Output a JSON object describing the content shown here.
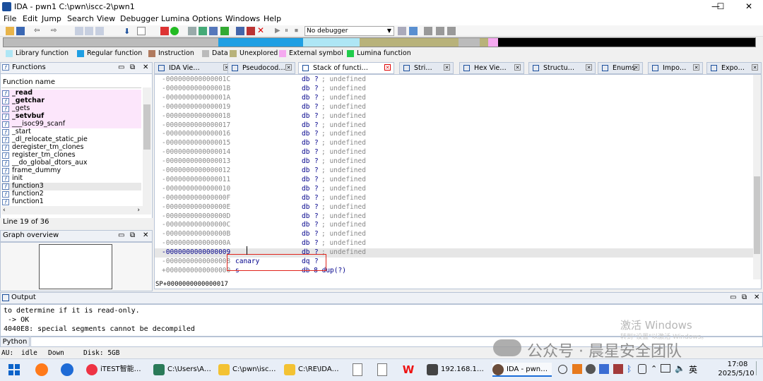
{
  "window": {
    "title": "IDA - pwn1 C:\\pwn\\iscc-2\\pwn1",
    "min": "—",
    "max": "☐",
    "close": "✕"
  },
  "menu": [
    "File",
    "Edit",
    "Jump",
    "Search",
    "View",
    "Debugger",
    "Lumina",
    "Options",
    "Windows",
    "Help"
  ],
  "toolbar": {
    "debugger_select": "No debugger"
  },
  "legend": [
    {
      "label": "Library function",
      "color": "#aee6f5"
    },
    {
      "label": "Regular function",
      "color": "#1f9fe3"
    },
    {
      "label": "Instruction",
      "color": "#b07a5e"
    },
    {
      "label": "Data",
      "color": "#bbbbbb"
    },
    {
      "label": "Unexplored",
      "color": "#b8b27a"
    },
    {
      "label": "External symbol",
      "color": "#f5a9f0"
    },
    {
      "label": "Lumina function",
      "color": "#1fcc4b"
    }
  ],
  "functions_panel": {
    "title": "Functions",
    "column_header": "Function name",
    "items": [
      "_read",
      "_getchar",
      "_gets",
      "_setvbuf",
      "___isoc99_scanf",
      "_start",
      "_dl_relocate_static_pie",
      "deregister_tm_clones",
      "register_tm_clones",
      "__do_global_dtors_aux",
      "frame_dummy",
      "init",
      "function3",
      "function2",
      "function1"
    ],
    "status": "Line 19 of 36"
  },
  "graph_overview": {
    "title": "Graph overview"
  },
  "tabs": [
    "IDA Vie…",
    "Pseudocod…",
    "Stack of functi…",
    "Stri…",
    "Hex Vie…",
    "Structu…",
    "Enums",
    "Impo…",
    "Expo…"
  ],
  "stack_rows": [
    {
      "off": "-000000000000001C",
      "name": "",
      "type": "db",
      "val": "?",
      "cmt": "; undefined"
    },
    {
      "off": "-000000000000001B",
      "name": "",
      "type": "db",
      "val": "?",
      "cmt": "; undefined"
    },
    {
      "off": "-000000000000001A",
      "name": "",
      "type": "db",
      "val": "?",
      "cmt": "; undefined"
    },
    {
      "off": "-0000000000000019",
      "name": "",
      "type": "db",
      "val": "?",
      "cmt": "; undefined"
    },
    {
      "off": "-0000000000000018",
      "name": "",
      "type": "db",
      "val": "?",
      "cmt": "; undefined"
    },
    {
      "off": "-0000000000000017",
      "name": "",
      "type": "db",
      "val": "?",
      "cmt": "; undefined"
    },
    {
      "off": "-0000000000000016",
      "name": "",
      "type": "db",
      "val": "?",
      "cmt": "; undefined"
    },
    {
      "off": "-0000000000000015",
      "name": "",
      "type": "db",
      "val": "?",
      "cmt": "; undefined"
    },
    {
      "off": "-0000000000000014",
      "name": "",
      "type": "db",
      "val": "?",
      "cmt": "; undefined"
    },
    {
      "off": "-0000000000000013",
      "name": "",
      "type": "db",
      "val": "?",
      "cmt": "; undefined"
    },
    {
      "off": "-0000000000000012",
      "name": "",
      "type": "db",
      "val": "?",
      "cmt": "; undefined"
    },
    {
      "off": "-0000000000000011",
      "name": "",
      "type": "db",
      "val": "?",
      "cmt": "; undefined"
    },
    {
      "off": "-0000000000000010",
      "name": "",
      "type": "db",
      "val": "?",
      "cmt": "; undefined"
    },
    {
      "off": "-000000000000000F",
      "name": "",
      "type": "db",
      "val": "?",
      "cmt": "; undefined"
    },
    {
      "off": "-000000000000000E",
      "name": "",
      "type": "db",
      "val": "?",
      "cmt": "; undefined"
    },
    {
      "off": "-000000000000000D",
      "name": "",
      "type": "db",
      "val": "?",
      "cmt": "; undefined"
    },
    {
      "off": "-000000000000000C",
      "name": "",
      "type": "db",
      "val": "?",
      "cmt": "; undefined"
    },
    {
      "off": "-000000000000000B",
      "name": "",
      "type": "db",
      "val": "?",
      "cmt": "; undefined"
    },
    {
      "off": "-000000000000000A",
      "name": "",
      "type": "db",
      "val": "?",
      "cmt": "; undefined"
    },
    {
      "off": "-0000000000000009",
      "name": "",
      "type": "db",
      "val": "?",
      "cmt": "; undefined"
    },
    {
      "off": "-0000000000000008",
      "name": "canary",
      "type": "dq",
      "val": "?",
      "cmt": ""
    },
    {
      "off": "+0000000000000000",
      "name": "s",
      "type": "db 8 dup(?)",
      "val": "",
      "cmt": ""
    }
  ],
  "stack_status": "SP+0000000000000017",
  "output": {
    "title": "Output",
    "lines": [
      "to determine if it is read-only.",
      " -> OK",
      "4040E8: special segments cannot be decompiled"
    ],
    "python_label": "Python"
  },
  "statusbar": {
    "au": "AU:",
    "state": "idle",
    "dir": "Down",
    "disk": "Disk: 5GB"
  },
  "watermark": {
    "activate": "激活 Windows",
    "hint": "转到\"设置\"以激活 Windows。",
    "brand": "公众号 · 晨星安全团队"
  },
  "taskbar": {
    "items": [
      "iTEST智能…",
      "C:\\Users\\A…",
      "C:\\pwn\\isc…",
      "C:\\RE\\IDA…",
      "192.168.1…",
      "IDA - pwn…"
    ],
    "ime": "英",
    "time": "17:08",
    "date": "2025/5/10"
  }
}
